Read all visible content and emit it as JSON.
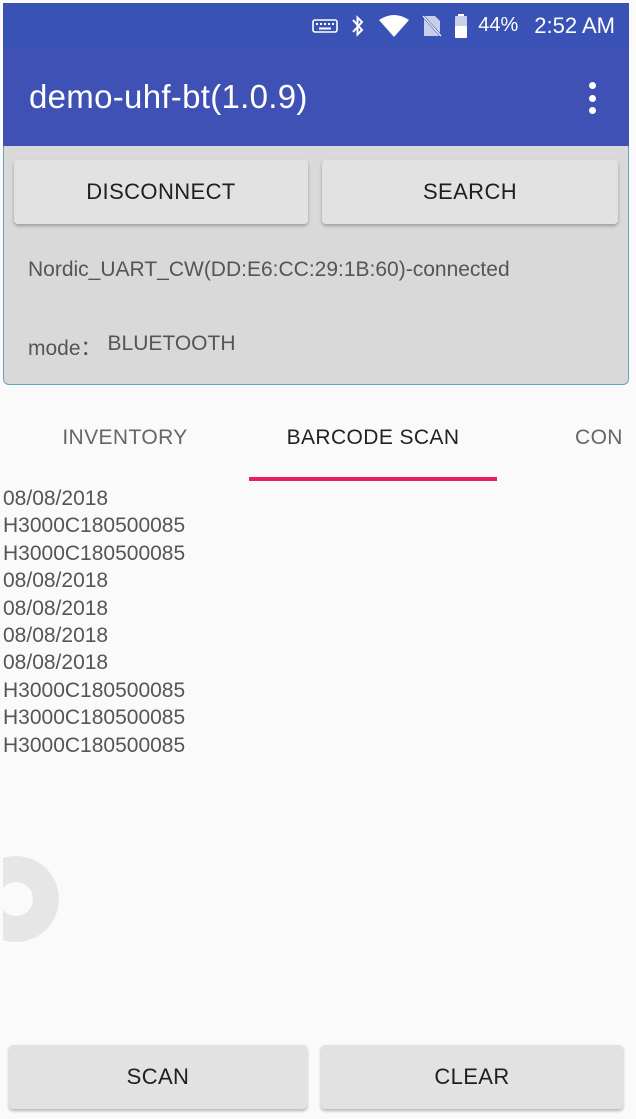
{
  "status_bar": {
    "battery_percent": "44%",
    "time": "2:52 AM",
    "icons": [
      "keyboard-icon",
      "bluetooth-icon",
      "wifi-icon",
      "no-sim-icon",
      "battery-icon"
    ]
  },
  "app_bar": {
    "title": "demo-uhf-bt(1.0.9)",
    "overflow_icon": "more-vert-icon"
  },
  "connection": {
    "disconnect_label": "DISCONNECT",
    "search_label": "SEARCH",
    "device_status": "Nordic_UART_CW(DD:E6:CC:29:1B:60)-connected",
    "mode_label": "mode：",
    "mode_value": "BLUETOOTH"
  },
  "tabs": [
    {
      "label": "INVENTORY",
      "selected": false
    },
    {
      "label": "BARCODE SCAN",
      "selected": true
    },
    {
      "label": "CON",
      "selected": false
    }
  ],
  "scan_results": [
    "08/08/2018",
    "H3000C180500085",
    "H3000C180500085",
    "08/08/2018",
    "08/08/2018",
    "08/08/2018",
    "08/08/2018",
    "H3000C180500085",
    "H3000C180500085",
    "H3000C180500085"
  ],
  "bottom_actions": {
    "scan_label": "SCAN",
    "clear_label": "CLEAR"
  },
  "colors": {
    "app_bar": "#3f51b5",
    "status_bar": "#3a51b5",
    "tab_indicator": "#e91e63",
    "panel_bg": "#d9d9d9",
    "button_bg": "#e2e2e2"
  }
}
